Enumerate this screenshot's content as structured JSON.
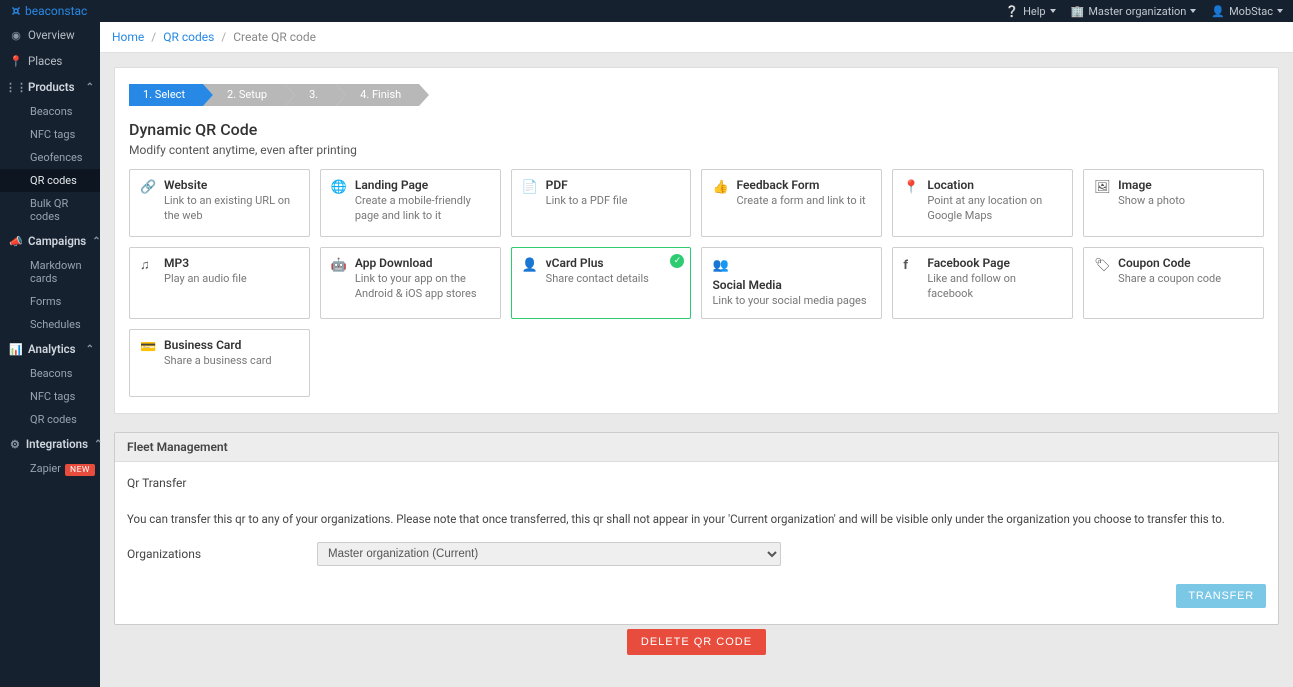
{
  "topbar": {
    "brand": "beaconstac",
    "help": "Help",
    "org": "Master organization",
    "user": "MobStac"
  },
  "sidebar": {
    "overview": "Overview",
    "places": "Places",
    "products": {
      "label": "Products",
      "beacons": "Beacons",
      "nfc": "NFC tags",
      "geofences": "Geofences",
      "qr": "QR codes",
      "bulk": "Bulk QR codes"
    },
    "campaigns": {
      "label": "Campaigns",
      "markdown": "Markdown cards",
      "forms": "Forms",
      "schedules": "Schedules"
    },
    "analytics": {
      "label": "Analytics",
      "beacons": "Beacons",
      "nfc": "NFC tags",
      "qr": "QR codes"
    },
    "integrations": {
      "label": "Integrations",
      "zapier": "Zapier",
      "zapier_badge": "NEW"
    }
  },
  "breadcrumb": {
    "home": "Home",
    "qr": "QR codes",
    "current": "Create QR code"
  },
  "stepper": {
    "s1": "1. Select",
    "s2": "2. Setup",
    "s3": "3.",
    "s4": "4. Finish"
  },
  "section": {
    "title": "Dynamic QR Code",
    "desc": "Modify content anytime, even after printing"
  },
  "cards": {
    "website": {
      "title": "Website",
      "desc": "Link to an existing URL on the web"
    },
    "landing": {
      "title": "Landing Page",
      "desc": "Create a mobile-friendly page and link to it"
    },
    "pdf": {
      "title": "PDF",
      "desc": "Link to a PDF file"
    },
    "feedback": {
      "title": "Feedback Form",
      "desc": "Create a form and link to it"
    },
    "location": {
      "title": "Location",
      "desc": "Point at any location on Google Maps"
    },
    "image": {
      "title": "Image",
      "desc": "Show a photo"
    },
    "mp3": {
      "title": "MP3",
      "desc": "Play an audio file"
    },
    "app": {
      "title": "App Download",
      "desc": "Link to your app on the Android & iOS app stores"
    },
    "vcard": {
      "title": "vCard Plus",
      "desc": "Share contact details"
    },
    "social": {
      "title": "Social Media",
      "desc": "Link to your social media pages"
    },
    "facebook": {
      "title": "Facebook Page",
      "desc": "Like and follow on facebook"
    },
    "coupon": {
      "title": "Coupon Code",
      "desc": "Share a coupon code"
    },
    "bizcard": {
      "title": "Business Card",
      "desc": "Share a business card"
    }
  },
  "fleet": {
    "header": "Fleet Management",
    "sub": "Qr Transfer",
    "note": "You can transfer this qr to any of your organizations. Please note that once transferred, this qr shall not appear in your 'Current organization' and will be visible only under the organization you choose to transfer this to.",
    "org_label": "Organizations",
    "org_value": "Master organization (Current)",
    "transfer_btn": "TRANSFER"
  },
  "delete_btn": "DELETE QR CODE"
}
